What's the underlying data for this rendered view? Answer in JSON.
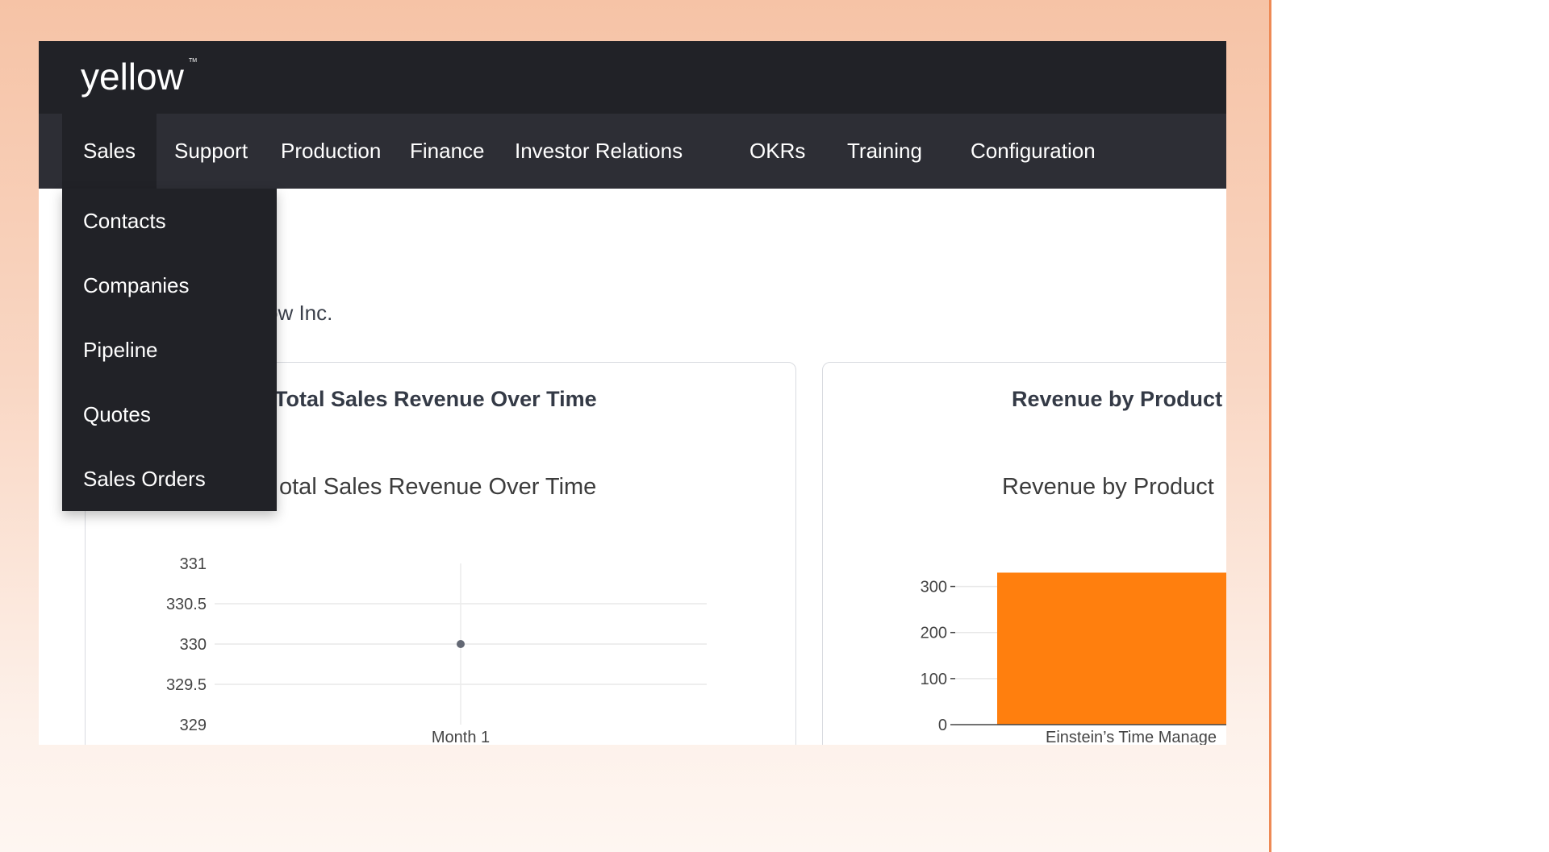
{
  "brand": {
    "logo_text": "yellow",
    "trademark": "TM"
  },
  "nav": {
    "items": [
      {
        "label": "Sales"
      },
      {
        "label": "Support"
      },
      {
        "label": "Production"
      },
      {
        "label": "Finance"
      },
      {
        "label": "Investor Relations"
      },
      {
        "label": "OKRs"
      },
      {
        "label": "Training"
      },
      {
        "label": "Configuration"
      }
    ],
    "active": "Sales"
  },
  "dropdown": {
    "items": [
      {
        "label": "Contacts"
      },
      {
        "label": "Companies"
      },
      {
        "label": "Pipeline"
      },
      {
        "label": "Quotes"
      },
      {
        "label": "Sales Orders"
      }
    ]
  },
  "page": {
    "company_text": "ow Inc."
  },
  "cards": [
    {
      "title": "Total Sales Revenue Over Time",
      "plot_title": "otal Sales Revenue Over Time"
    },
    {
      "title": "Revenue by Product",
      "plot_title": "Revenue by Product"
    }
  ],
  "colors": {
    "topbar": "#212227",
    "navbar": "#2d2e35",
    "bar": "#ff7f0e",
    "point": "#636874"
  },
  "chart_data": [
    {
      "type": "scatter",
      "title": "Total Sales Revenue Over Time",
      "categories": [
        "Month 1"
      ],
      "values": [
        330
      ],
      "y_ticks": [
        "331",
        "330.5",
        "330",
        "329.5",
        "329"
      ],
      "ylim": [
        329,
        331
      ],
      "grid": true
    },
    {
      "type": "bar",
      "title": "Revenue by Product",
      "categories": [
        "Einstein’s Time Manage"
      ],
      "values": [
        330
      ],
      "y_ticks": [
        "300",
        "200",
        "100",
        "0"
      ],
      "ylim": [
        0,
        350
      ],
      "grid": true
    }
  ]
}
